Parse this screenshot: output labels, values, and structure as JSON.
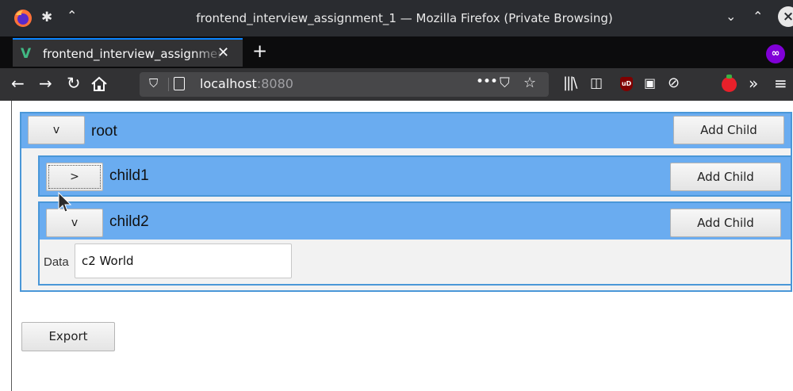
{
  "window": {
    "title": "frontend_interview_assignment_1 — Mozilla Firefox (Private Browsing)"
  },
  "tab": {
    "label": "frontend_interview_assignment_1",
    "close": "✕",
    "new_tab": "+"
  },
  "nav": {
    "url_host": "localhost",
    "url_port": ":8080",
    "more": "•••"
  },
  "tree": {
    "root": {
      "name": "root",
      "toggle": "v",
      "add_label": "Add Child"
    },
    "children": [
      {
        "name": "child1",
        "toggle": ">",
        "add_label": "Add Child",
        "expanded": false
      },
      {
        "name": "child2",
        "toggle": "v",
        "add_label": "Add Child",
        "expanded": true,
        "data_label": "Data",
        "data_value": "c2 World"
      }
    ]
  },
  "export_label": "Export",
  "colors": {
    "node_header": "#6aacf0",
    "node_border": "#4a97d8",
    "titlebar": "#2a2c30",
    "toolbar": "#323234",
    "private_badge": "#8000d7"
  }
}
